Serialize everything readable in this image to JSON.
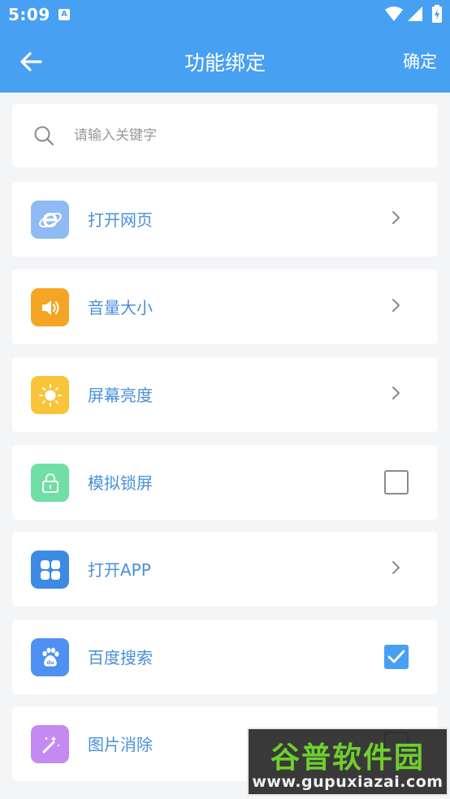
{
  "status_bar": {
    "time": "5:09",
    "notification_letter": "A"
  },
  "app_bar": {
    "title": "功能绑定",
    "confirm_label": "确定"
  },
  "search": {
    "placeholder": "请输入关键字",
    "value": ""
  },
  "items": [
    {
      "label": "打开网页",
      "icon": "browser-icon",
      "color": "#8fbaf3",
      "control": "chevron"
    },
    {
      "label": "音量大小",
      "icon": "speaker-icon",
      "color": "#f5a524",
      "control": "chevron"
    },
    {
      "label": "屏幕亮度",
      "icon": "sun-icon",
      "color": "#f8c53a",
      "control": "chevron"
    },
    {
      "label": "模拟锁屏",
      "icon": "lock-icon",
      "color": "#6fdfa5",
      "control": "checkbox",
      "checked": false
    },
    {
      "label": "打开APP",
      "icon": "apps-icon",
      "color": "#3d8ae3",
      "control": "chevron"
    },
    {
      "label": "百度搜索",
      "icon": "baidu-icon",
      "color": "#4f91f2",
      "control": "checkbox",
      "checked": true
    },
    {
      "label": "图片消除",
      "icon": "magic-wand-icon",
      "color": "#c58af2",
      "control": "checkbox",
      "checked": false
    }
  ],
  "colors": {
    "primary": "#48a0f3",
    "label_text": "#4a8fd8"
  },
  "watermark": {
    "title": "谷普软件园",
    "url": "www.gupuxiazai.com"
  }
}
